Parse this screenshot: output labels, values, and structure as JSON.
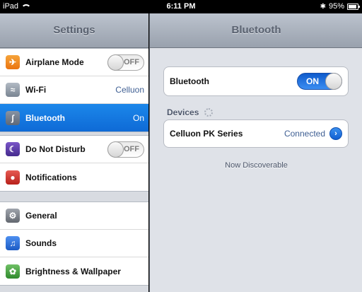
{
  "status_bar": {
    "device": "iPad",
    "time": "6:11 PM",
    "battery": "95%",
    "battery_level": 0.95,
    "icons": [
      "wifi-icon",
      "bluetooth-icon",
      "battery-icon"
    ]
  },
  "master": {
    "title": "Settings",
    "groups": [
      [
        {
          "id": "airplane",
          "label": "Airplane Mode",
          "icon": "airplane-icon",
          "icon_color": "#f28c1b",
          "toggle": "OFF"
        },
        {
          "id": "wifi",
          "label": "Wi-Fi",
          "icon": "wifi-icon",
          "icon_color": "#8e99a6",
          "value": "Celluon"
        },
        {
          "id": "bluetooth",
          "label": "Bluetooth",
          "icon": "bluetooth-icon",
          "icon_color": "#6b7787",
          "value": "On",
          "selected": true
        }
      ],
      [
        {
          "id": "dnd",
          "label": "Do Not Disturb",
          "icon": "moon-icon",
          "icon_color": "#5b3aa8",
          "toggle": "OFF"
        },
        {
          "id": "notifications",
          "label": "Notifications",
          "icon": "notifications-icon",
          "icon_color": "#d9322b"
        }
      ],
      [
        {
          "id": "general",
          "label": "General",
          "icon": "gear-icon",
          "icon_color": "#7d828a"
        },
        {
          "id": "sounds",
          "label": "Sounds",
          "icon": "speaker-icon",
          "icon_color": "#2a6fd6"
        },
        {
          "id": "brightness",
          "label": "Brightness & Wallpaper",
          "icon": "flower-icon",
          "icon_color": "#3c9b3a"
        }
      ]
    ]
  },
  "detail": {
    "title": "Bluetooth",
    "bluetooth_row": {
      "label": "Bluetooth",
      "toggle": "ON"
    },
    "devices_header": "Devices",
    "device": {
      "name": "Celluon PK Series",
      "status": "Connected"
    },
    "footer": "Now Discoverable"
  },
  "colors": {
    "selection_blue": "#1c87ea",
    "value_text": "#3f5f93",
    "toggle_on": "#2f7fe8"
  }
}
